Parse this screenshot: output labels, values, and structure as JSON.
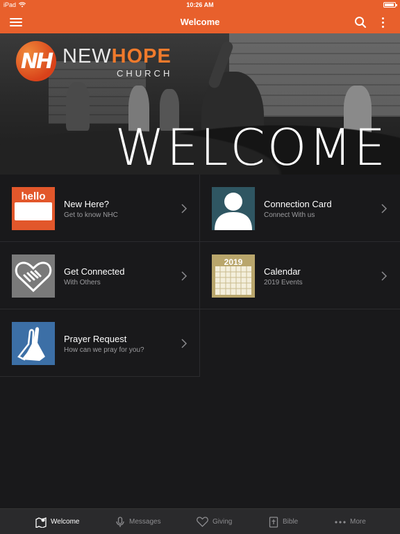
{
  "status_bar": {
    "device": "iPad",
    "time": "10:26 AM"
  },
  "nav": {
    "title": "Welcome"
  },
  "hero": {
    "logo_mark": "NH",
    "logo_new": "NEW",
    "logo_hope": "HOPE",
    "logo_sub": "CHURCH",
    "heading": "WELCOME"
  },
  "tiles": [
    {
      "label": "New Here?",
      "sub": "Get to know NHC",
      "thumb": "hello-tag-icon",
      "thumb_text": "hello",
      "color": "#e2572b"
    },
    {
      "label": "Connection Card",
      "sub": "Connect With us",
      "thumb": "person-silhouette-icon",
      "color": "#2f5662"
    },
    {
      "label": "Get Connected",
      "sub": "With Others",
      "thumb": "heart-handshake-icon",
      "color": "#7a7a7a"
    },
    {
      "label": "Calendar",
      "sub": "2019 Events",
      "thumb": "calendar-icon",
      "thumb_text": "2019",
      "color": "#b9a66c"
    },
    {
      "label": "Prayer Request",
      "sub": "How can we pray for you?",
      "thumb": "praying-hands-icon",
      "color": "#3c6fa6"
    }
  ],
  "tabs": [
    {
      "label": "Welcome",
      "icon": "map-pin-icon",
      "active": true
    },
    {
      "label": "Messages",
      "icon": "microphone-icon",
      "active": false
    },
    {
      "label": "Giving",
      "icon": "heart-icon",
      "active": false
    },
    {
      "label": "Bible",
      "icon": "bible-cross-icon",
      "active": false
    },
    {
      "label": "More",
      "icon": "more-dots-icon",
      "active": false
    }
  ],
  "colors": {
    "accent": "#e8602c",
    "background": "#19191b",
    "tabbar": "#2a2a2c"
  }
}
